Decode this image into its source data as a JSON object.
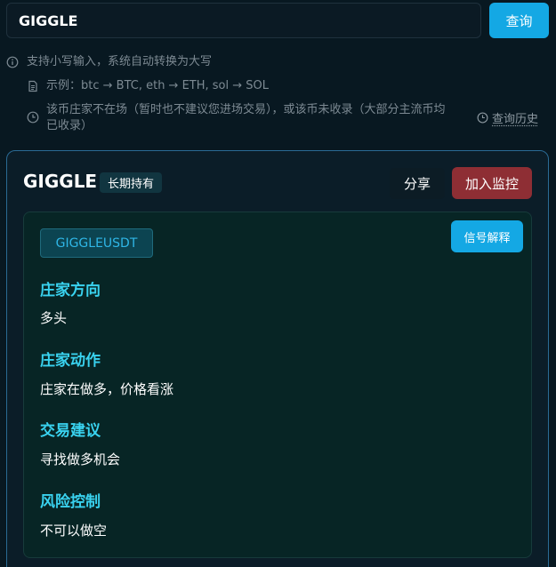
{
  "search": {
    "value": "GIGGLE",
    "button_label": "查询"
  },
  "hints": {
    "uppercase": "支持小写输入，系统自动转换为大写",
    "example": "示例：btc → BTC, eth → ETH, sol → SOL",
    "warning_line1": "该币庄家不在场（暂时也不建议您进场交易），或该币未收录（大部分主流币均",
    "warning_line2": "已收录）",
    "history_link": "查询历史"
  },
  "result": {
    "symbol": "GIGGLE",
    "badge": "长期持有",
    "share_label": "分享",
    "monitor_label": "加入监控",
    "pair": "GIGGLEUSDT",
    "explain_label": "信号解释",
    "sections": [
      {
        "title": "庄家方向",
        "value": "多头"
      },
      {
        "title": "庄家动作",
        "value": "庄家在做多，价格看涨"
      },
      {
        "title": "交易建议",
        "value": "寻找做多机会"
      },
      {
        "title": "风险控制",
        "value": "不可以做空"
      }
    ]
  },
  "colors": {
    "background": "#081821",
    "accent_blue": "#14a8e4",
    "monitor_red": "#8e2e34",
    "section_title_cyan": "#39d2ef"
  },
  "icons": {
    "uppercase_hint": "info-icon",
    "example_hint": "document-icon",
    "warning_hint": "clock-icon",
    "history": "clock-icon"
  }
}
